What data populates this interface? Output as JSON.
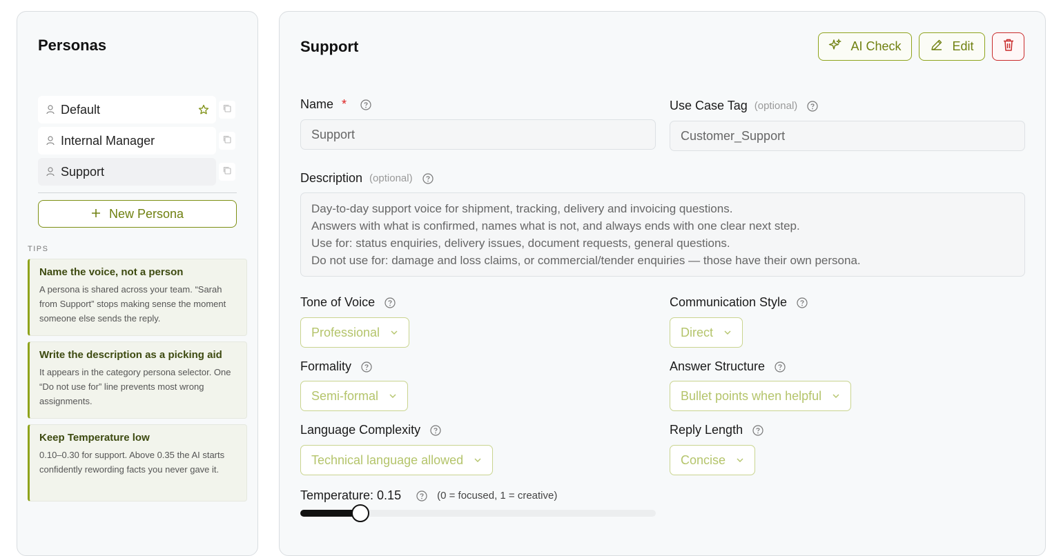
{
  "sidebar": {
    "title": "Personas",
    "personas": [
      {
        "label": "Default",
        "starred": true
      },
      {
        "label": "Internal Manager",
        "starred": false
      },
      {
        "label": "Support",
        "starred": false,
        "active": true
      }
    ],
    "new_persona_label": "New Persona",
    "tips_label": "TIPS",
    "tips": [
      {
        "title": "Name the voice, not a person",
        "body": "A persona is shared across your team. “Sarah from Support” stops making sense the moment someone else sends the reply."
      },
      {
        "title": "Write the description as a picking aid",
        "body": "It appears in the category persona selector. One “Do not use for” line prevents most wrong assignments."
      },
      {
        "title": "Keep Temperature low",
        "body": "0.10–0.30 for support. Above 0.35 the AI starts confidently rewording facts you never gave it."
      }
    ]
  },
  "detail": {
    "title": "Support",
    "ai_check_label": "AI Check",
    "edit_label": "Edit",
    "fields": {
      "name_label": "Name",
      "name_required": "*",
      "name_value": "Support",
      "use_case_label": "Use Case Tag",
      "use_case_optional": "(optional)",
      "use_case_value": "Customer_Support",
      "description_label": "Description",
      "description_optional": "(optional)",
      "description_lines": [
        "Day-to-day support voice for shipment, tracking, delivery and invoicing questions.",
        "Answers with what is confirmed, names what is not, and always ends with one clear next step.",
        "Use for: status enquiries, delivery issues, document requests, general questions.",
        "Do not use for: damage and loss claims, or commercial/tender enquiries — those have their own persona."
      ],
      "tone_label": "Tone of Voice",
      "tone_value": "Professional",
      "comm_style_label": "Communication Style",
      "comm_style_value": "Direct",
      "formality_label": "Formality",
      "formality_value": "Semi-formal",
      "answer_structure_label": "Answer Structure",
      "answer_structure_value": "Bullet points when helpful",
      "language_label": "Language Complexity",
      "language_value": "Technical language allowed",
      "reply_length_label": "Reply Length",
      "reply_length_value": "Concise",
      "temperature_label": "Temperature: 0.15",
      "temperature_hint": "(0 = focused, 1 = creative)",
      "temperature_value": 0.15
    }
  },
  "colors": {
    "accent": "#7d8f12",
    "danger": "#c92a2a",
    "select_text": "#b4c46b"
  }
}
